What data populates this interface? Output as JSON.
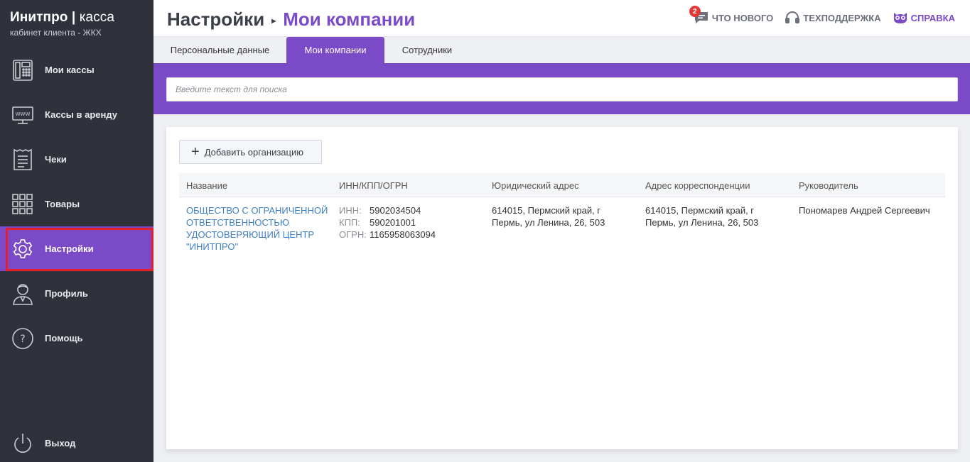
{
  "brand": {
    "title_bold": "Инитпро",
    "title_sep": " | ",
    "title_thin": "касса",
    "subtitle": "кабинет клиента - ЖКХ"
  },
  "sidebar": {
    "items": [
      {
        "label": "Мои кассы",
        "icon": "cash-register-icon"
      },
      {
        "label": "Кассы в аренду",
        "icon": "www-monitor-icon"
      },
      {
        "label": "Чеки",
        "icon": "receipt-icon"
      },
      {
        "label": "Товары",
        "icon": "grid-icon"
      },
      {
        "label": "Настройки",
        "icon": "gear-icon",
        "active": true
      },
      {
        "label": "Профиль",
        "icon": "user-icon"
      },
      {
        "label": "Помощь",
        "icon": "help-icon"
      }
    ],
    "logout": {
      "label": "Выход",
      "icon": "power-icon"
    }
  },
  "header": {
    "crumb_root": "Настройки",
    "crumb_sep": "▸",
    "crumb_current": "Мои компании",
    "whats_new": {
      "label": "Что нового",
      "badge": "2",
      "icon": "chat-icon"
    },
    "support": {
      "label": "Техподдержка",
      "icon": "headset-icon"
    },
    "help": {
      "label": "Справка",
      "icon": "owl-icon"
    }
  },
  "tabs": [
    {
      "label": "Персональные данные"
    },
    {
      "label": "Мои компании",
      "active": true
    },
    {
      "label": "Сотрудники"
    }
  ],
  "search": {
    "placeholder": "Введите текст для поиска",
    "value": ""
  },
  "add_button": {
    "label": "Добавить организацию"
  },
  "table": {
    "columns": [
      "Название",
      "ИНН/КПП/ОГРН",
      "Юридический адрес",
      "Адрес корреспонденции",
      "Руководитель"
    ],
    "rows": [
      {
        "name_lines": [
          "Общество с ограниченной",
          "ответственностью",
          "удостоверяющий центр",
          "\"ИНИТПРО\""
        ],
        "inn_label": "ИНН:",
        "inn": "5902034504",
        "kpp_label": "КПП:",
        "kpp": "590201001",
        "ogrn_label": "ОГРН:",
        "ogrn": "1165958063094",
        "legal_address_lines": [
          "614015, Пермский край, г",
          "Пермь, ул Ленина, 26, 503"
        ],
        "mail_address_lines": [
          "614015, Пермский край, г",
          "Пермь, ул Ленина, 26, 503"
        ],
        "director": "Пономарев Андрей Сергеевич"
      }
    ]
  },
  "colors": {
    "accent": "#7b4ac7",
    "sidebar_bg": "#2f323b",
    "link": "#3d7fc4",
    "highlight": "#e3202a",
    "badge": "#e53935"
  }
}
